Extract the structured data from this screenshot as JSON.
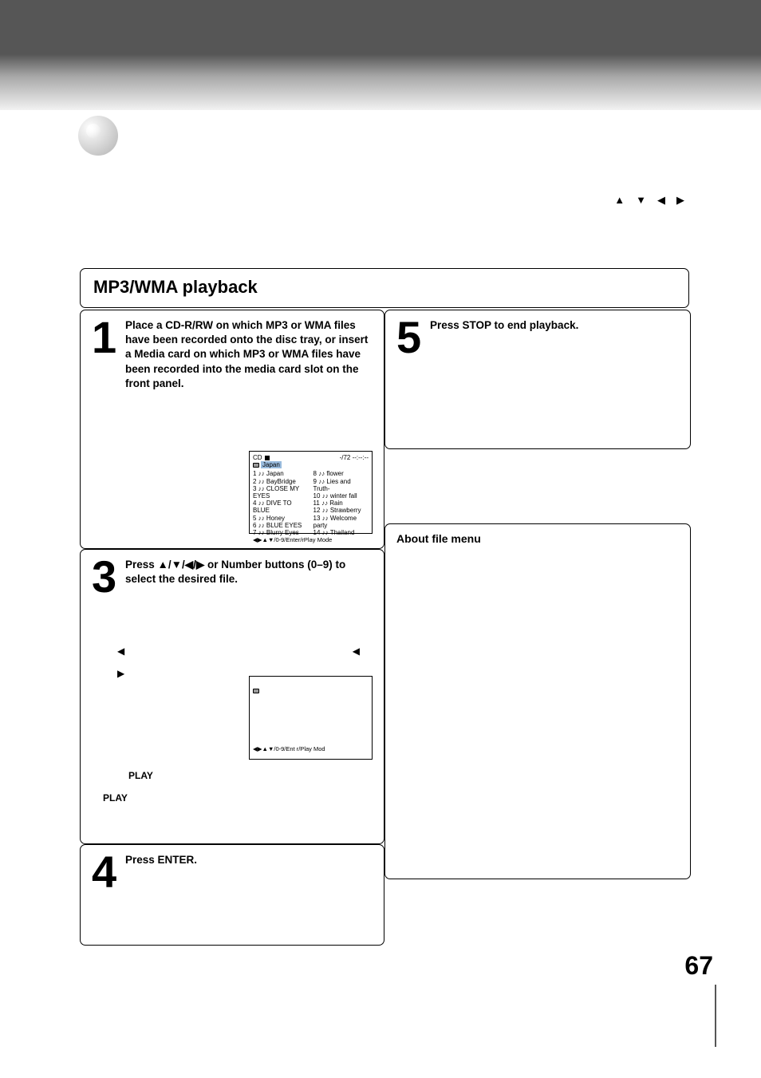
{
  "page_number": "67",
  "section_title": "MP3/WMA playback",
  "arrow_glyphs": [
    "▲",
    "▼",
    "◀",
    "▶"
  ],
  "steps": {
    "s1": {
      "num": "1",
      "text": "Place a CD-R/RW on which MP3 or WMA files have been recorded onto the disc tray, or insert a Media card on which MP3 or WMA files have been recorded into the media card slot on the front panel."
    },
    "s3": {
      "num": "3",
      "text": "Press ▲/▼/◀/▶ or Number buttons (0–9) to select the desired file.",
      "body_a": "◀",
      "body_b": "▶",
      "play1": "PLAY",
      "play2": "PLAY"
    },
    "s4": {
      "num": "4",
      "text": "Press ENTER."
    },
    "s5": {
      "num": "5",
      "text": "Press STOP to end playback."
    }
  },
  "about_heading": "About file menu",
  "osd": {
    "stop_glyph": "■",
    "time": "-/72   --:--:--",
    "cd_label": "CD",
    "folder_label": "Japan",
    "left_items": [
      "1  ♪♪ Japan",
      "2  ♪♪ BayBridge",
      "3  ♪♪ CLOSE MY EYES",
      "4  ♪♪ DIVE TO BLUE",
      "5  ♪♪ Honey",
      "6  ♪♪ BLUE EYES",
      "7  ♪♪ Blurry Eyes"
    ],
    "right_items": [
      "8  ♪♪ flower",
      "9  ♪♪ Lies and Truth-",
      "10 ♪♪ winter fall",
      "11 ♪♪ Rain",
      "12 ♪♪ Strawberry",
      "13 ♪♪ Welcome party",
      "14 ♪♪ Thailand"
    ],
    "footer1": "◀▶▲▼/0-9/Enter/rPlay Mode",
    "footer2": "◀▶▲▼/0-9/Ent  r/Play Mod"
  }
}
